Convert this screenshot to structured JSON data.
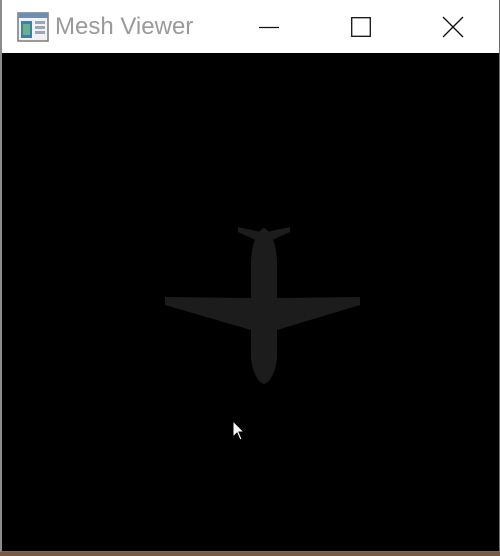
{
  "window": {
    "title": "Mesh Viewer",
    "app_icon": "mesh-viewer-app-icon",
    "controls": {
      "minimize_icon": "minimize-icon",
      "maximize_icon": "maximize-icon",
      "close_icon": "close-icon"
    }
  },
  "viewport": {
    "background": "#000000",
    "model": "airplane-mesh",
    "model_color": "#1c1c1c"
  },
  "cursor": "arrow-cursor-icon"
}
